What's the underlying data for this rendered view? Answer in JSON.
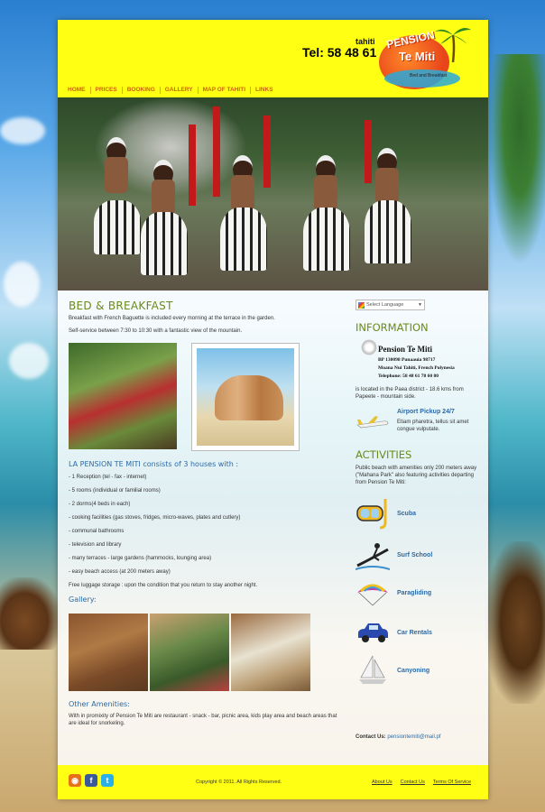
{
  "header": {
    "tel_small": "tahiti",
    "tel": "Tel: 58 48 61",
    "logo": {
      "line1": "PENSION",
      "line2": "Te Miti",
      "sub": "Bed and Breakfast"
    }
  },
  "nav": [
    "HOME",
    "PRICES",
    "BOOKING",
    "GALLERY",
    "MAP OF TAHITI",
    "LINKS"
  ],
  "main": {
    "title": "BED & BREAKFAST",
    "intro1": "Breakfast with French Baguette is included every morning at the terrace in the garden.",
    "intro2": "Self-service between 7:30  to 10:30 with a fantastic view of the mountain.",
    "houses_heading": "LA PENSION TE MITI consists of 3 houses with :",
    "amenities": [
      "- 1 Reception (tel - fax - internet)",
      "- 5 rooms (individual or familial rooms)",
      "- 2 dorms(4 beds in each)",
      "- cooking facilities (gas stoves, fridges, micro-waves, plates and cutlery)",
      "- communal bathrooms",
      "- television and library",
      "- many terraces - large gardens (hammocks, lounging area)",
      "- easy beach access (at 200 meters away)"
    ],
    "luggage": "Free luggage storage : upon the condition that you return to stay another night.",
    "gallery_heading": "Gallery:",
    "other_heading": "Other Amenities:",
    "other_text": "With in promixity  of Pension Te Miti are restaurant - snack - bar, picnic area, kids play area and beach areas that are ideal for snorkeling."
  },
  "sidebar": {
    "translate": "Select Language",
    "info_heading": "INFORMATION",
    "pension_card": {
      "name": "Pension Te Miti",
      "lines": [
        "BP 130098 Punaauia 98717",
        "Moana Nui Tahiti, French Polynesia",
        "Telephone: 58 48 61 78 60 80"
      ]
    },
    "location": "is located in the Paea district - 18.6 kms from Papeete - mountain side.",
    "pickup": {
      "title": "Airport Pickup 24/7",
      "text": "Etiam pharetra, tellus sit amet congue vulputate."
    },
    "activities_heading": "ACTIVITIES",
    "activities_text": "Public beach with amenities only 200 meters away (\"Mahana Park\" also featuring activities departing from Pension Te Miti:",
    "activities": [
      {
        "label": "Scuba",
        "icon": "scuba-mask-icon"
      },
      {
        "label": "Surf School",
        "icon": "surfer-icon"
      },
      {
        "label": "Paragliding",
        "icon": "paraglider-icon"
      },
      {
        "label": "Car Rentals",
        "icon": "car-icon"
      },
      {
        "label": "Canyoning",
        "icon": "sailboat-icon"
      }
    ],
    "contact_label": "Contact Us:",
    "contact_email": "pensiontemiti@mail.pf"
  },
  "footer": {
    "copyright": "Copyright © 2011. All Rights Reserved.",
    "links": [
      "About Us",
      "Contact Us",
      "Terms Of Service"
    ]
  },
  "colors": {
    "header": "#ffff14",
    "heading_green": "#6a8a1a",
    "link_blue": "#2a6aa8",
    "nav_orange": "#d0600a"
  }
}
